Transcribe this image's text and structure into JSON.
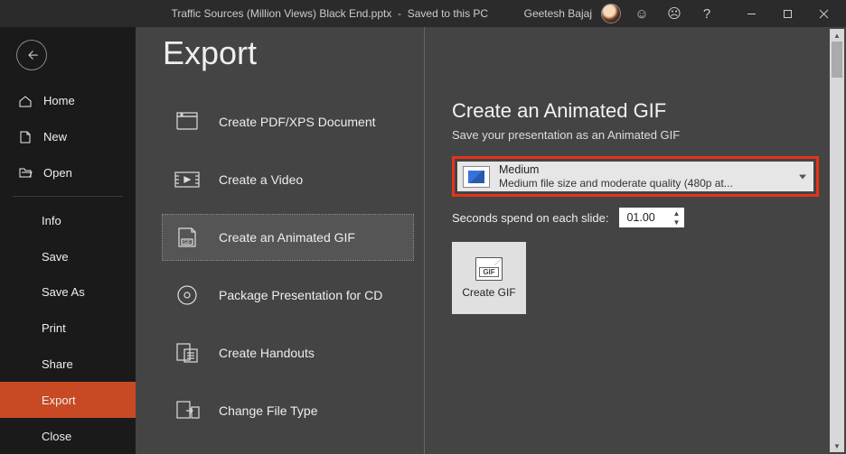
{
  "titlebar": {
    "filename": "Traffic Sources (Million Views) Black End.pptx",
    "status": "Saved to this PC",
    "user": "Geetesh Bajaj"
  },
  "sidebar": {
    "home": "Home",
    "new": "New",
    "open": "Open",
    "info": "Info",
    "save": "Save",
    "save_as": "Save As",
    "print": "Print",
    "share": "Share",
    "export": "Export",
    "close": "Close"
  },
  "page": {
    "title": "Export",
    "options": {
      "pdf": "Create PDF/XPS Document",
      "video": "Create a Video",
      "gif": "Create an Animated GIF",
      "cd": "Package Presentation for CD",
      "handouts": "Create Handouts",
      "filetype": "Change File Type"
    }
  },
  "gif_panel": {
    "title": "Create an Animated GIF",
    "subtitle": "Save your presentation as an Animated GIF",
    "quality_label": "Medium",
    "quality_desc": "Medium file size and moderate quality (480p at...",
    "seconds_label": "Seconds spend on each slide:",
    "seconds_value": "01.00",
    "create_button": "Create GIF"
  }
}
